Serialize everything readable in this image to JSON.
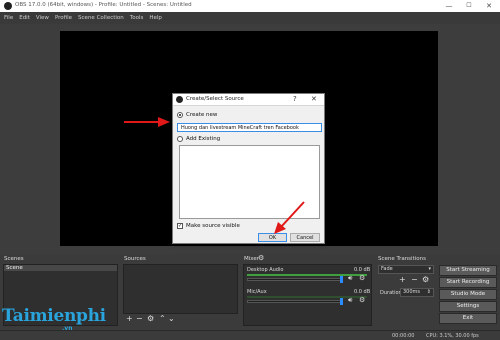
{
  "window": {
    "title": "OBS 17.0.0 (64bit, windows) - Profile: Untitled - Scenes: Untitled",
    "minimize": "—",
    "maximize": "☐",
    "close": "✕"
  },
  "menu": [
    "File",
    "Edit",
    "View",
    "Profile",
    "Scene Collection",
    "Tools",
    "Help"
  ],
  "dialog": {
    "title": "Create/Select Source",
    "help": "?",
    "close": "✕",
    "create_new_label": "Create new",
    "name_value": "Huong dan livestream MineCraft tren Facebook",
    "add_existing_label": "Add Existing",
    "make_visible_label": "Make source visible",
    "make_visible_checked": true,
    "ok_label": "OK",
    "cancel_label": "Cancel"
  },
  "docks": {
    "scenes_title": "Scenes",
    "scenes": [
      "Scene"
    ],
    "sources_title": "Sources",
    "mixer_title": "Mixer",
    "transitions_title": "Scene Transitions"
  },
  "mixer": {
    "channels": [
      {
        "name": "Desktop Audio",
        "db": "0.0 dB"
      },
      {
        "name": "Mic/Aux",
        "db": "0.0 dB"
      }
    ]
  },
  "transitions": {
    "selected": "Fade",
    "duration_label": "Duration",
    "duration_value": "300ms"
  },
  "controls": {
    "start_streaming": "Start Streaming",
    "start_recording": "Start Recording",
    "studio_mode": "Studio Mode",
    "settings": "Settings",
    "exit": "Exit"
  },
  "status": {
    "time": "00:00:00",
    "cpu": "CPU: 3.1%, 30.00 fps"
  },
  "watermark": {
    "main": "Taimienphi",
    "sub": ".vn"
  },
  "colors": {
    "accent": "#3a8ee6",
    "arrow": "#e01818",
    "meter": "#3f9f3f",
    "watermark": "#2aa4dc"
  }
}
